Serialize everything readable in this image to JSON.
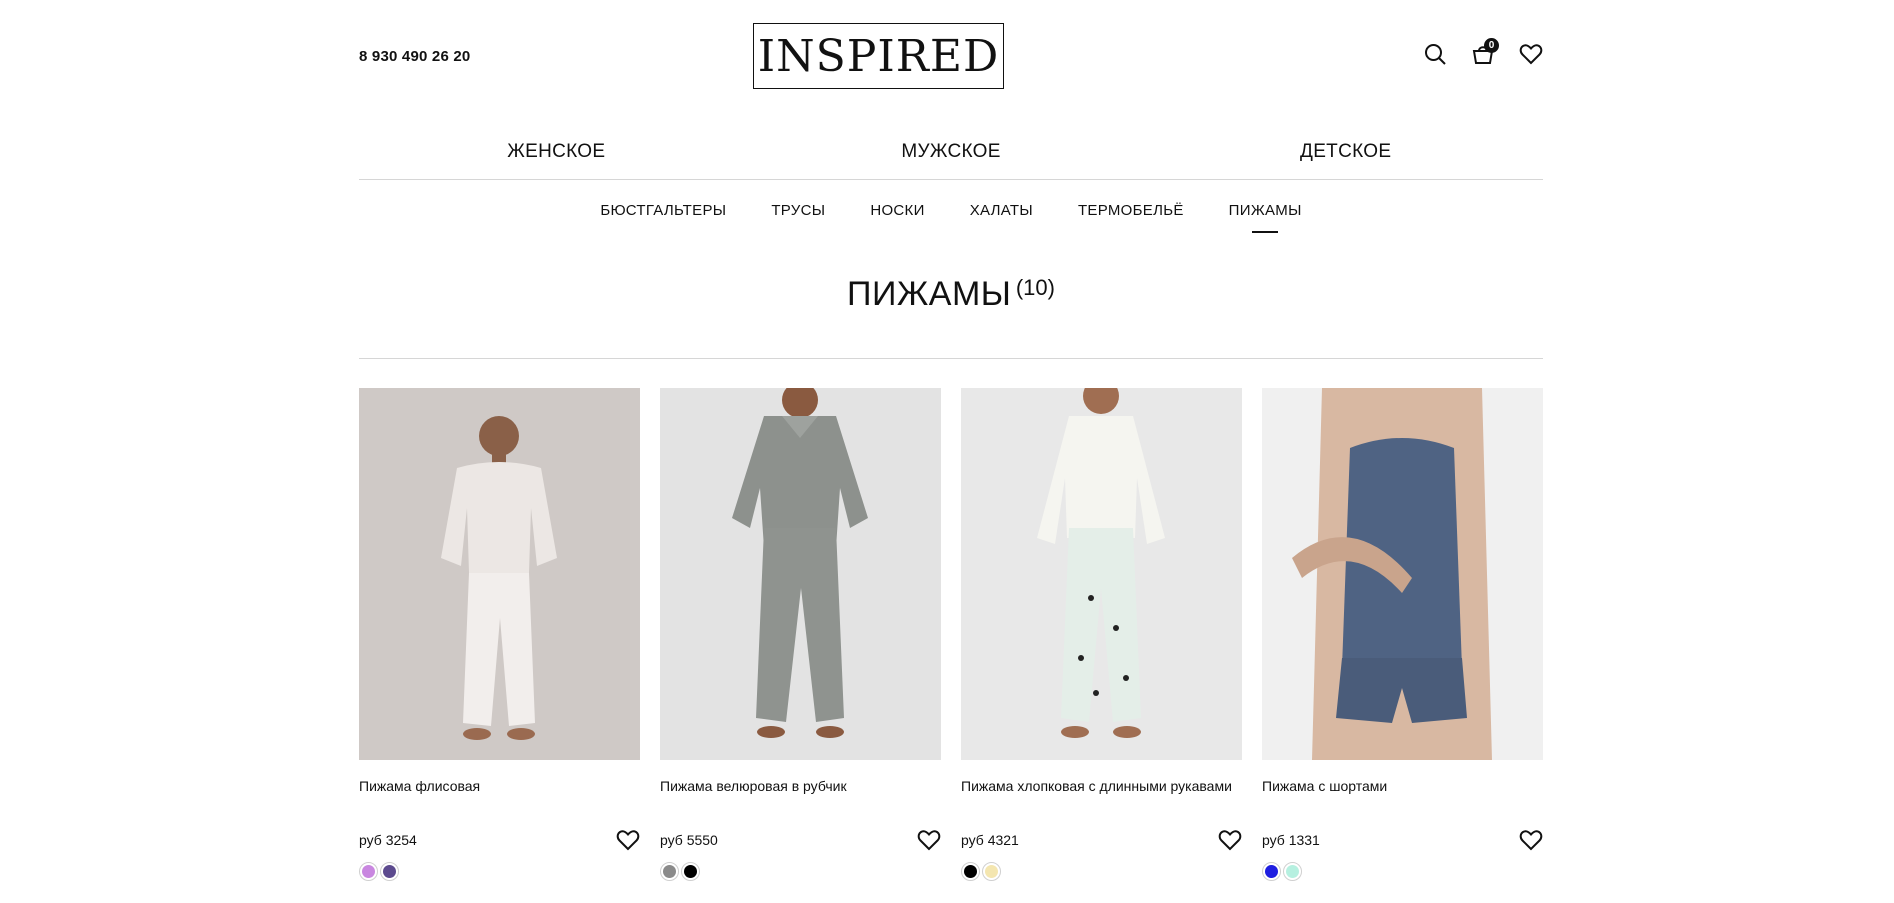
{
  "header": {
    "phone": "8 930 490 26 20",
    "logo": "INSPIRED",
    "cart_count": "0"
  },
  "main_nav": [
    "ЖЕНСКОЕ",
    "МУЖСКОЕ",
    "ДЕТСКОЕ"
  ],
  "sub_nav": [
    "БЮСТГАЛЬТЕРЫ",
    "ТРУСЫ",
    "НОСКИ",
    "ХАЛАТЫ",
    "ТЕРМОБЕЛЬЁ",
    "ПИЖАМЫ"
  ],
  "active_sub": "ПИЖАМЫ",
  "category": {
    "title": "ПИЖАМЫ",
    "count": "(10)"
  },
  "products": [
    {
      "name": "Пижама флисовая",
      "price": "руб 3254",
      "colors": [
        "#c987e0",
        "#5c4a8e"
      ],
      "photo_bg": "#cfc9c6"
    },
    {
      "name": "Пижама велюровая в рубчик",
      "price": "руб 5550",
      "colors": [
        "#8a8a8a",
        "#000000"
      ],
      "photo_bg": "#e3e3e3"
    },
    {
      "name": "Пижама хлопковая с длинными рукавами",
      "price": "руб 4321",
      "colors": [
        "#000000",
        "#f4e6b0"
      ],
      "photo_bg": "#e8e8e8"
    },
    {
      "name": "Пижама с шортами",
      "price": "руб 1331",
      "colors": [
        "#1e1ee0",
        "#b6f0e0"
      ],
      "photo_bg": "#f0f0f0"
    }
  ],
  "icons": {
    "search": "search-icon",
    "cart": "cart-icon",
    "favorites": "heart-icon"
  }
}
